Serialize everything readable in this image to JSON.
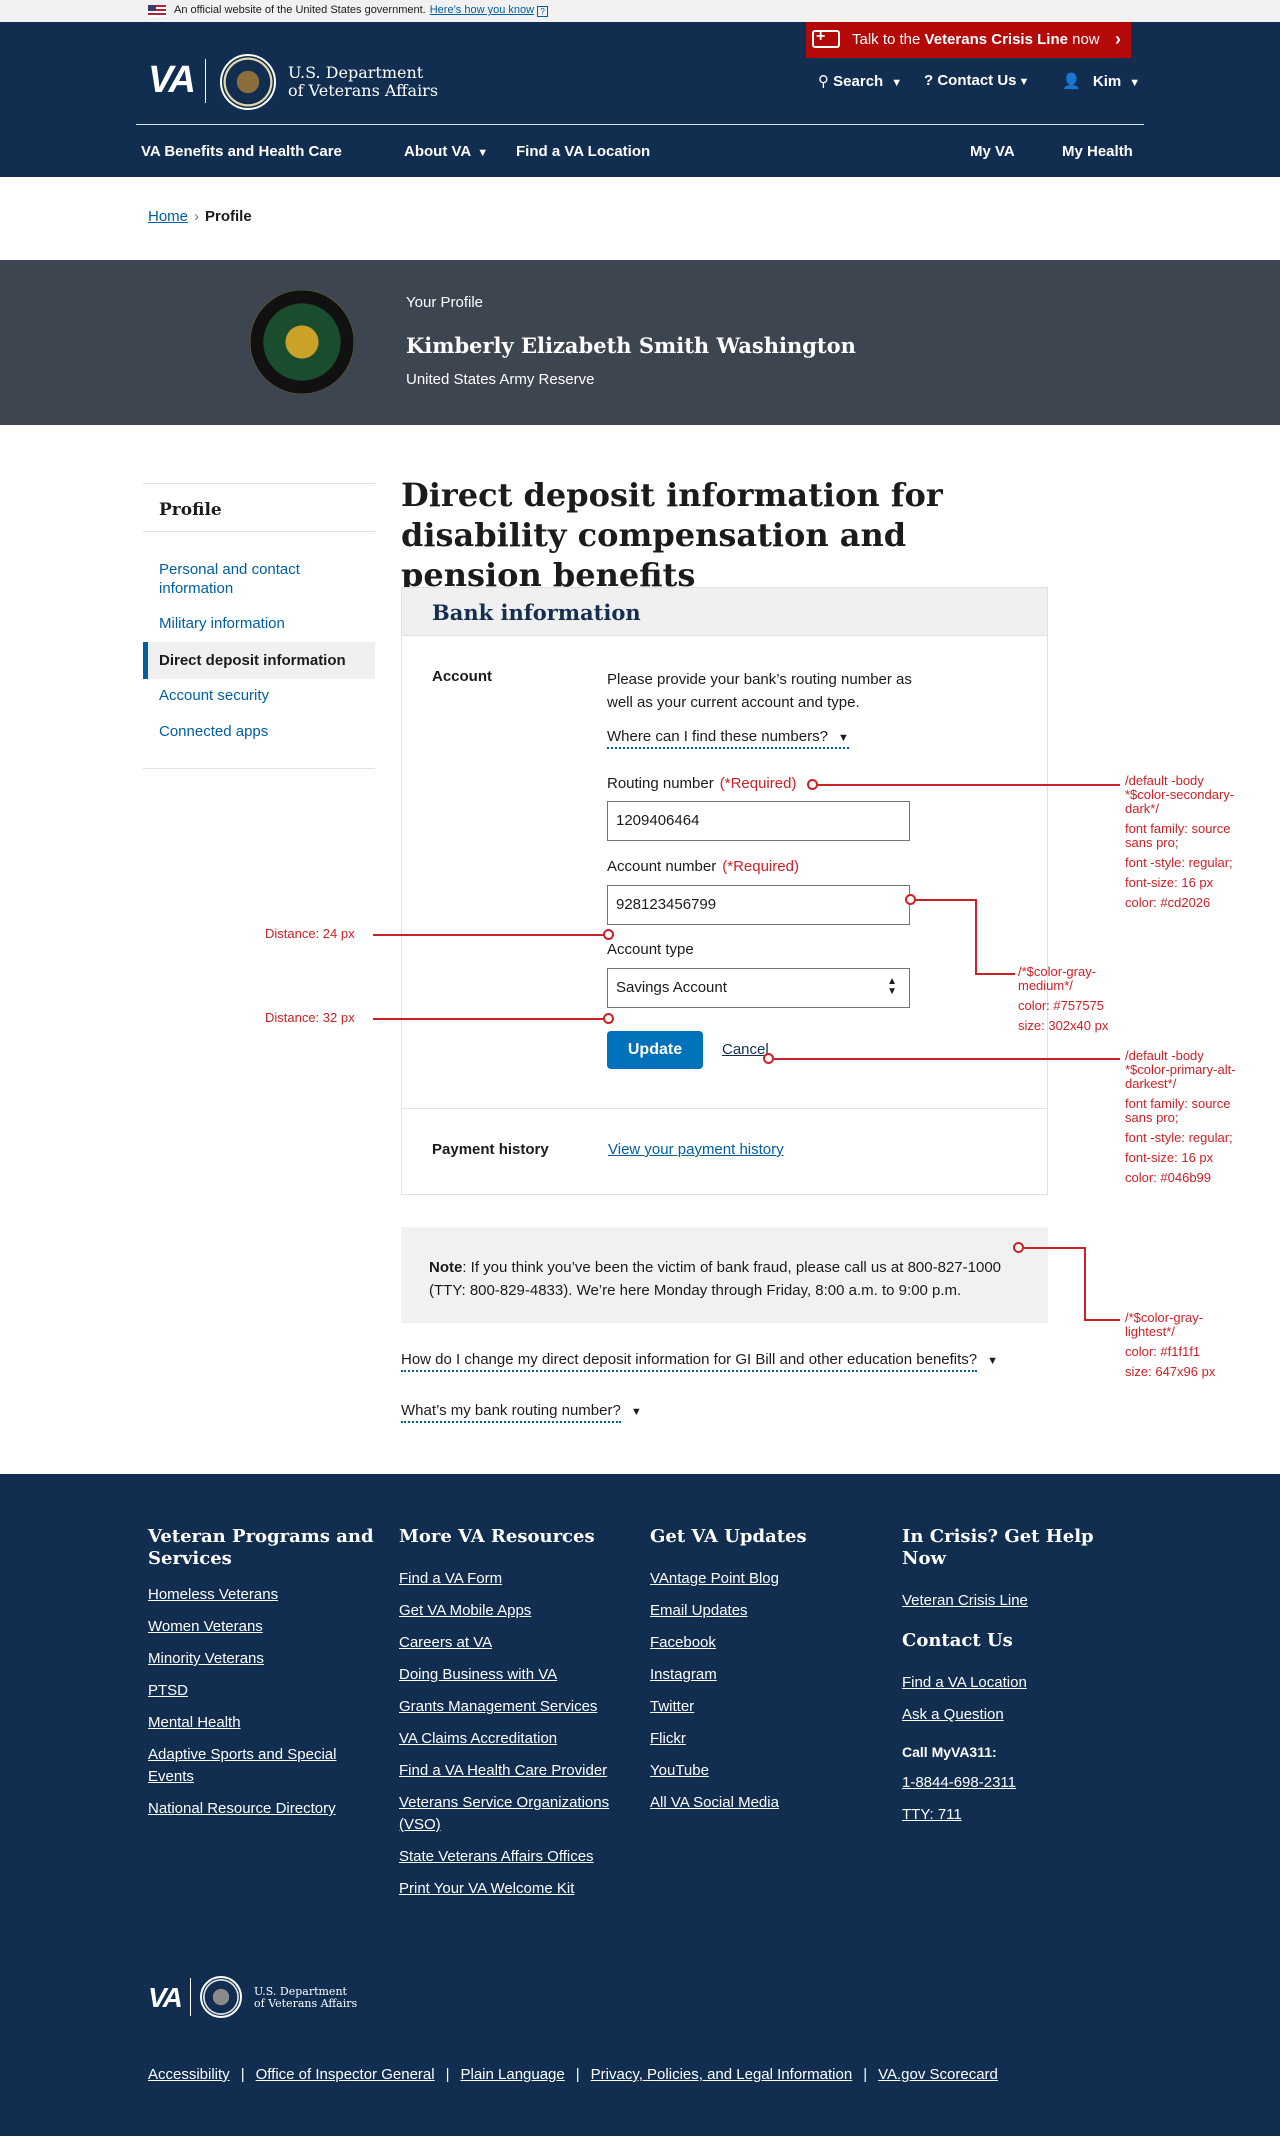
{
  "banner": {
    "text": "An official website of the United States government.",
    "link": "Here’s how you know"
  },
  "crisis": {
    "prefix": "Talk to the ",
    "bold": "Veterans Crisis Line",
    "suffix": " now"
  },
  "logo": {
    "mark": "VA",
    "dept_line1": "U.S. Department",
    "dept_line2": "of Veterans Affairs"
  },
  "header_util": {
    "search": "Search",
    "contact": "Contact Us",
    "user": "Kim"
  },
  "main_nav": {
    "benefits": "VA Benefits and Health Care",
    "about": "About VA",
    "find": "Find a VA Location",
    "my_va": "My VA",
    "my_health": "My Health"
  },
  "breadcrumb": {
    "home": "Home",
    "separator": "›",
    "current": "Profile"
  },
  "hero": {
    "label": "Your Profile",
    "name": "Kimberly Elizabeth Smith Washington",
    "branch": "United States Army Reserve"
  },
  "sidebar": {
    "title": "Profile",
    "items": [
      {
        "label": "Personal and contact information"
      },
      {
        "label": "Military information"
      },
      {
        "label": "Direct deposit information"
      },
      {
        "label": "Account security"
      },
      {
        "label": "Connected apps"
      }
    ]
  },
  "page": {
    "title": "Direct deposit information for disability compensation and pension benefits"
  },
  "bank": {
    "heading": "Bank information",
    "account_label": "Account",
    "intro": "Please provide your bank’s routing number as well as your current account and type.",
    "where_link": "Where can I find these numbers?",
    "routing_label": "Routing number",
    "required": "(*Required)",
    "routing_value": "1209406464",
    "account_number_label": "Account number",
    "account_value": "928123456799",
    "account_type_label": "Account type",
    "account_type_value": "Savings Account",
    "update_button": "Update",
    "cancel_link": "Cancel",
    "payment_history_label": "Payment history",
    "payment_history_link": "View your payment history"
  },
  "note": {
    "bold": "Note",
    "text": ": If you think you’ve been the victim of bank fraud, please call us at 800-827-1000 (TTY: 800-829-4833). We’re here Monday through Friday, 8:00 a.m. to 9:00 p.m."
  },
  "accordions": [
    {
      "label": "How do I change my direct deposit information for GI Bill and other education benefits?"
    },
    {
      "label": "What’s my bank routing number?"
    }
  ],
  "annotations": {
    "required_style": [
      "/default -body",
      "*$color-secondary-",
      "dark*/",
      "font family: source",
      "sans pro;",
      "font -style: regular;",
      "font-size: 16 px",
      "color: #cd2026"
    ],
    "input_style": [
      "/*$color-gray-",
      "medium*/",
      "color: #757575",
      "size: 302x40 px"
    ],
    "link_style": [
      "/default -body",
      "*$color-primary-alt-",
      "darkest*/",
      "font family: source",
      "sans pro;",
      "font -style: regular;",
      "font-size: 16 px",
      "color: #046b99"
    ],
    "note_style": [
      "/*$color-gray-",
      "lightest*/",
      "color: #f1f1f1",
      "size: 647x96 px"
    ],
    "distance_24": "Distance: 24 px",
    "distance_32": "Distance: 32 px"
  },
  "footer": {
    "col1": {
      "title": "Veteran Programs and Services",
      "links": [
        "Homeless Veterans",
        "Women Veterans",
        "Minority Veterans",
        "PTSD",
        "Mental Health",
        "Adaptive Sports and Special Events",
        "National Resource Directory"
      ]
    },
    "col2": {
      "title": "More VA Resources",
      "links": [
        "Find a VA Form",
        "Get VA Mobile Apps",
        "Careers at VA",
        "Doing Business with VA",
        "Grants Management Services",
        "VA Claims Accreditation",
        "Find a VA Health Care Provider",
        "Veterans Service Organizations (VSO)",
        "State Veterans Affairs Offices",
        "Print Your VA Welcome Kit"
      ]
    },
    "col3": {
      "title": "Get VA Updates",
      "links": [
        "VAntage Point Blog",
        "Email Updates",
        "Facebook",
        "Instagram",
        "Twitter",
        "Flickr",
        "YouTube",
        "All VA Social Media"
      ]
    },
    "col4": {
      "title": "In Crisis? Get Help Now",
      "crisis_link": "Veteran Crisis Line",
      "contact_title": "Contact Us",
      "contact_links": [
        "Find a VA Location",
        "Ask a Question"
      ],
      "call_label": "Call MyVA311:",
      "phone": "1-8844-698-2311",
      "tty": "TTY: 711"
    },
    "bottom_links": [
      "Accessibility",
      "Office of Inspector General",
      "Plain Language",
      "Privacy, Policies, and Legal Information",
      "VA.gov Scorecard"
    ],
    "separator": "|"
  },
  "colors": {
    "header_bg": "#112e51",
    "crisis_red": "#b50909",
    "link_blue": "#005ea2",
    "required_red": "#cd2026",
    "hero_bg": "#3d4551",
    "button_blue": "#0071bb",
    "note_bg": "#f1f1f1"
  },
  "icons": [
    "us-flag-icon",
    "crisis-line-icon",
    "search-icon",
    "help-icon",
    "user-icon",
    "chevron-down-icon",
    "chevron-right-icon",
    "select-arrows-icon"
  ]
}
